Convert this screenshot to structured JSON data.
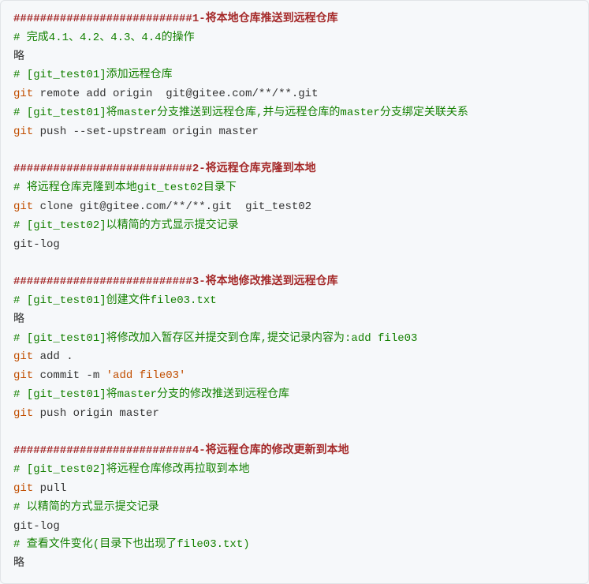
{
  "sections": {
    "s1": {
      "header": "###########################1-将本地仓库推送到远程仓库",
      "c1": "# 完成4.1、4.2、4.3、4.4的操作",
      "omit1": "略",
      "c2": "# [git_test01]添加远程仓库",
      "l1_cmd": "git",
      "l1_args": " remote add origin  git@gitee.com/**/**.git",
      "c3": "# [git_test01]将master分支推送到远程仓库,并与远程仓库的master分支绑定关联关系",
      "l2_cmd": "git",
      "l2_args": " push --set-upstream origin master"
    },
    "s2": {
      "header": "###########################2-将远程仓库克隆到本地",
      "c1": "# 将远程仓库克隆到本地git_test02目录下",
      "l1_cmd": "git",
      "l1_args": " clone git@gitee.com/**/**.git  git_test02",
      "c2": "# [git_test02]以精简的方式显示提交记录",
      "l2": "git-log"
    },
    "s3": {
      "header": "###########################3-将本地修改推送到远程仓库",
      "c1": "# [git_test01]创建文件file03.txt",
      "omit1": "略",
      "c2": "# [git_test01]将修改加入暂存区并提交到仓库,提交记录内容为:add file03",
      "l1_cmd": "git",
      "l1_args": " add .",
      "l2_cmd": "git",
      "l2_mid": " commit -m ",
      "l2_str": "'add file03'",
      "c3": "# [git_test01]将master分支的修改推送到远程仓库",
      "l3_cmd": "git",
      "l3_args": " push origin master"
    },
    "s4": {
      "header": "###########################4-将远程仓库的修改更新到本地",
      "c1": "# [git_test02]将远程仓库修改再拉取到本地",
      "l1_cmd": "git",
      "l1_args": " pull",
      "c2": "# 以精简的方式显示提交记录",
      "l2": "git-log",
      "c3": "# 查看文件变化(目录下也出现了file03.txt)",
      "omit1": "略"
    }
  }
}
